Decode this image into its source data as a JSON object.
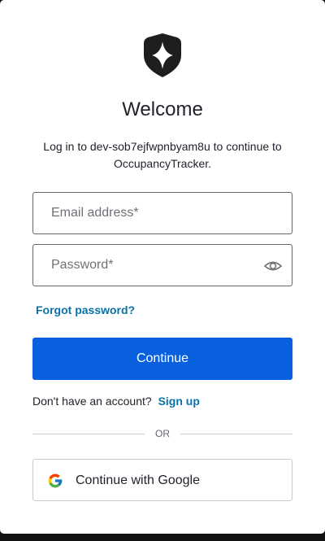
{
  "header": {
    "logo_icon": "shield-star-logo",
    "title": "Welcome",
    "subtitle": "Log in to dev-sob7ejfwpnbyam8u to continue to OccupancyTracker."
  },
  "form": {
    "email": {
      "value": "",
      "placeholder": "Email address*"
    },
    "password": {
      "value": "",
      "placeholder": "Password*",
      "toggle_icon": "eye-icon"
    },
    "forgot_password_label": "Forgot password?",
    "continue_label": "Continue"
  },
  "signup": {
    "prompt": "Don't have an account?",
    "link_label": "Sign up"
  },
  "divider": {
    "label": "OR"
  },
  "social": {
    "google_label": "Continue with Google",
    "google_icon": "google-icon"
  },
  "colors": {
    "primary": "#0860df",
    "link": "#0a72a8",
    "text": "#1e212a",
    "border": "#c9cace",
    "background": "#121212"
  }
}
